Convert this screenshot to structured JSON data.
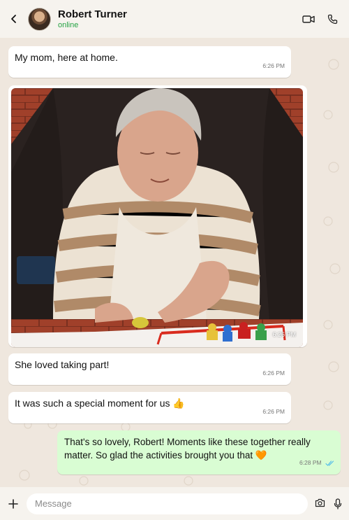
{
  "header": {
    "contact_name": "Robert Turner",
    "status": "online",
    "icons": [
      "back-icon",
      "video-call-icon",
      "phone-icon"
    ]
  },
  "messages": [
    {
      "type": "text",
      "direction": "in",
      "text": "My mom, here at home.",
      "time": "6:26 PM"
    },
    {
      "type": "image",
      "direction": "in",
      "time": "6:26 PM"
    },
    {
      "type": "text",
      "direction": "in",
      "text": "She loved taking part!",
      "time": "6:26 PM"
    },
    {
      "type": "text",
      "direction": "in",
      "text": "It was such a special moment for us 👍",
      "time": "6:26 PM"
    },
    {
      "type": "text",
      "direction": "out",
      "text": "That's so lovely, Robert! Moments like these together really matter. So glad the activities brought you that 🧡",
      "time": "6:28 PM",
      "read": true
    }
  ],
  "composer": {
    "placeholder": "Message",
    "icons": [
      "plus-icon",
      "camera-icon",
      "microphone-icon"
    ]
  },
  "colors": {
    "background": "#efe7de",
    "outgoing_bubble": "#d9fdd3",
    "incoming_bubble": "#ffffff",
    "online": "#25a244",
    "read_ticks": "#53bdeb"
  }
}
